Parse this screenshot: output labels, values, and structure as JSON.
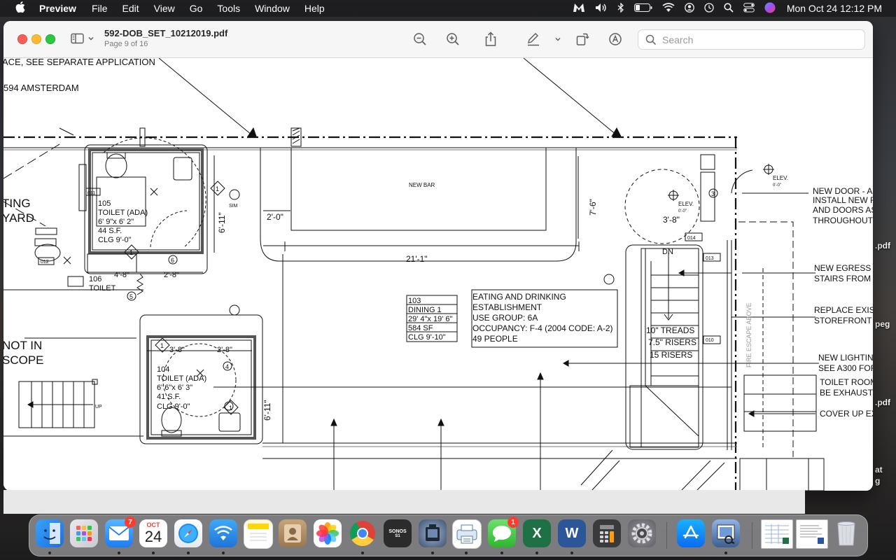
{
  "menubar": {
    "app_name": "Preview",
    "items": [
      "File",
      "Edit",
      "View",
      "Go",
      "Tools",
      "Window",
      "Help"
    ],
    "clock": "Mon Oct 24  12:12 PM"
  },
  "window": {
    "doc_title": "592-DOB_SET_10212019.pdf",
    "page_info": "Page 9 of 16",
    "search_placeholder": "Search"
  },
  "drawing": {
    "top_note_1": "ACE, SEE SEPARATE APPLICATION",
    "top_note_2": "594 AMSTERDAM",
    "left_label_1": "TING",
    "left_label_2": "YARD",
    "left_label_3": "NOT IN",
    "left_label_4": "SCOPE",
    "new_bar": "NEW BAR",
    "dim_2_0": "2'-0\"",
    "dim_21_1": "21'-1\"",
    "dim_7_6": "7'-6\"",
    "dim_6_11_a": "6'-11\"",
    "dim_6_11_b": "6'-11\"",
    "dim_3_8_a": "3'-8\"",
    "dim_3_8_b": "3'-8\"",
    "dim_2_8_a": "2'-8\"",
    "dim_2_8_b": "2'-8\"",
    "dim_4_8": "4'-8\"",
    "room105": [
      "105",
      "TOILET (ADA)",
      "6' 9\"x 6' 2\"",
      "44 S.F.",
      "CLG      9'-0\""
    ],
    "room106": [
      "106",
      "TOILET"
    ],
    "room104": [
      "104",
      "TOILET (ADA)",
      "6' 6\"x 6' 3\"",
      "41 S.F.",
      "CLG      9'-0\""
    ],
    "room103": [
      "103",
      "DINING 1",
      "29' 4\"x 19' 6\"",
      "584 SF",
      "CLG      9'-10\""
    ],
    "establishment": [
      "EATING AND DRINKING",
      "ESTABLISHMENT",
      "USE GROUP:    6A",
      "OCCUPANCY:  F-4 (2004 CODE: A-2)",
      "49 PEOPLE"
    ],
    "stairs": [
      "10\" TREADS",
      "7.5\" RISERS",
      "15 RISERS"
    ],
    "dn": "DN",
    "up": "UP",
    "elev_a": "ELEV.",
    "elev_a_val": "0'-0\"",
    "elev_b": "ELEV.",
    "elev_b_val": "0'-0\"",
    "fire_escape": "FIRE ESCAPE ABOVE",
    "tags": [
      "011",
      "012",
      "013",
      "014",
      "010"
    ],
    "diamond_1": "1",
    "circle_3": "3",
    "circle_4": "4",
    "circle_5": "5",
    "circle_6": "6",
    "sim": "SIM",
    "right_notes": [
      [
        "NEW DOOR - AD",
        "INSTALL NEW F",
        "AND DOORS AS",
        "THROUGHOUT"
      ],
      [
        "NEW EGRESS",
        "STAIRS FROM"
      ],
      [
        "REPLACE EXIST",
        "STOREFRONT"
      ],
      [
        "NEW LIGHTING",
        "SEE A300 FOR"
      ],
      [
        "TOILET ROOM",
        "BE EXHAUSTE"
      ],
      [
        "COVER UP EX"
      ]
    ]
  },
  "desktop_labels": [
    ".pdf",
    "peg",
    ".pdf",
    "at",
    "g"
  ],
  "dock": {
    "mail_badge": "7",
    "calendar_month": "OCT",
    "calendar_day": "24",
    "sonos_line1": "SONOS",
    "sonos_line2": "S1",
    "messages_badge": "1",
    "excel_letter": "X",
    "word_letter": "W"
  }
}
